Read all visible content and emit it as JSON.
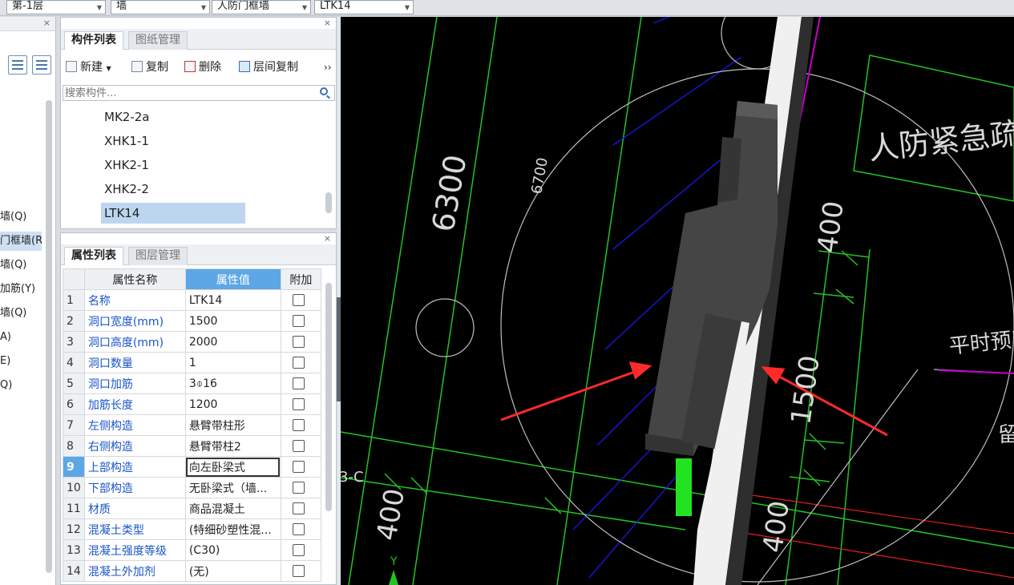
{
  "topbar": {
    "floor": "第-1层",
    "category": "墙",
    "subtype": "人防门框墙",
    "component": "LTK14"
  },
  "nav": {
    "items": [
      "墙(Q)",
      "门框墙(R",
      "墙(Q)",
      "加筋(Y)",
      "墙(Q)",
      "A)",
      "E)",
      "Q)"
    ]
  },
  "component_panel": {
    "tabs": [
      "构件列表",
      "图纸管理"
    ],
    "toolbar": {
      "new": "新建",
      "copy": "复制",
      "delete": "删除",
      "floor_copy": "层间复制",
      "more": "››"
    },
    "search_placeholder": "搜索构件...",
    "items": [
      "MK2-2a",
      "XHK1-1",
      "XHK2-1",
      "XHK2-2",
      "LTK14"
    ],
    "selected": "LTK14"
  },
  "property_panel": {
    "tabs": [
      "属性列表",
      "图层管理"
    ],
    "headers": {
      "name": "属性名称",
      "value": "属性值",
      "extra": "附加"
    },
    "rows": [
      {
        "idx": "1",
        "name": "名称",
        "value": "LTK14"
      },
      {
        "idx": "2",
        "name": "洞口宽度(mm)",
        "value": "1500"
      },
      {
        "idx": "3",
        "name": "洞口高度(mm)",
        "value": "2000"
      },
      {
        "idx": "4",
        "name": "洞口数量",
        "value": "1"
      },
      {
        "idx": "5",
        "name": "洞口加筋",
        "value": "3⌽16"
      },
      {
        "idx": "6",
        "name": "加筋长度",
        "value": "1200"
      },
      {
        "idx": "7",
        "name": "左侧构造",
        "value": "悬臂带柱形"
      },
      {
        "idx": "8",
        "name": "右侧构造",
        "value": "悬臂带柱2"
      },
      {
        "idx": "9",
        "name": "上部构造",
        "value": "向左卧梁式"
      },
      {
        "idx": "10",
        "name": "下部构造",
        "value": "无卧梁式（墙..."
      },
      {
        "idx": "11",
        "name": "材质",
        "value": "商品混凝土"
      },
      {
        "idx": "12",
        "name": "混凝土类型",
        "value": "(特细砂塑性混..."
      },
      {
        "idx": "13",
        "name": "混凝土强度等级",
        "value": "(C30)"
      },
      {
        "idx": "14",
        "name": "混凝土外加剂",
        "value": "(无)"
      }
    ],
    "selected_row": "9"
  },
  "cad": {
    "labels": {
      "dim_6300": "6300",
      "dim_6700": "6700",
      "dim_400_a": "400",
      "dim_1500": "1500",
      "dim_400_b": "400",
      "dim_400_c": "400",
      "axis": "3-C",
      "room_name": "人防紧急疏散",
      "note": "平时预留",
      "partial": "留",
      "y_axis": "Y"
    },
    "colors": {
      "background": "#000000",
      "axis_line": "#22c322",
      "grid_blue": "#1a1aff",
      "circle": "#bfbfbf",
      "wall_dark": "#454545",
      "wall_light": "#f0f0f0",
      "arrow": "#ff2a2a",
      "magenta": "#c800c8"
    }
  }
}
